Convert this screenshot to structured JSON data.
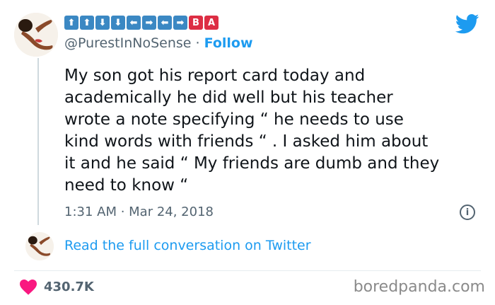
{
  "author": {
    "name_keys": [
      "⬆",
      "⬆",
      "⬇",
      "⬇",
      "⬅",
      "➡",
      "⬅",
      "➡",
      "B",
      "A"
    ],
    "handle": "@PurestInNoSense",
    "separator": "·",
    "follow_label": "Follow"
  },
  "tweet": {
    "text": "My son got his report card today and\nacademically he did well but his teacher\nwrote a note specifying “ he needs to use\nkind words with friends “ . I asked him about\nit and he said “ My friends are dumb and they\nneed to know “",
    "timestamp": "1:31 AM · Mar 24, 2018"
  },
  "info_icon_glyph": "i",
  "read_link": "Read the full conversation on Twitter",
  "likes": "430.7K",
  "watermark": "boredpanda.com",
  "colors": {
    "accent": "#1d9bf0",
    "like": "#f91880",
    "key_blue": "#3b88c3",
    "key_red": "#dd2e44"
  },
  "icons": [
    "avatar",
    "twitter-bird-icon",
    "info-icon",
    "heart-icon"
  ]
}
